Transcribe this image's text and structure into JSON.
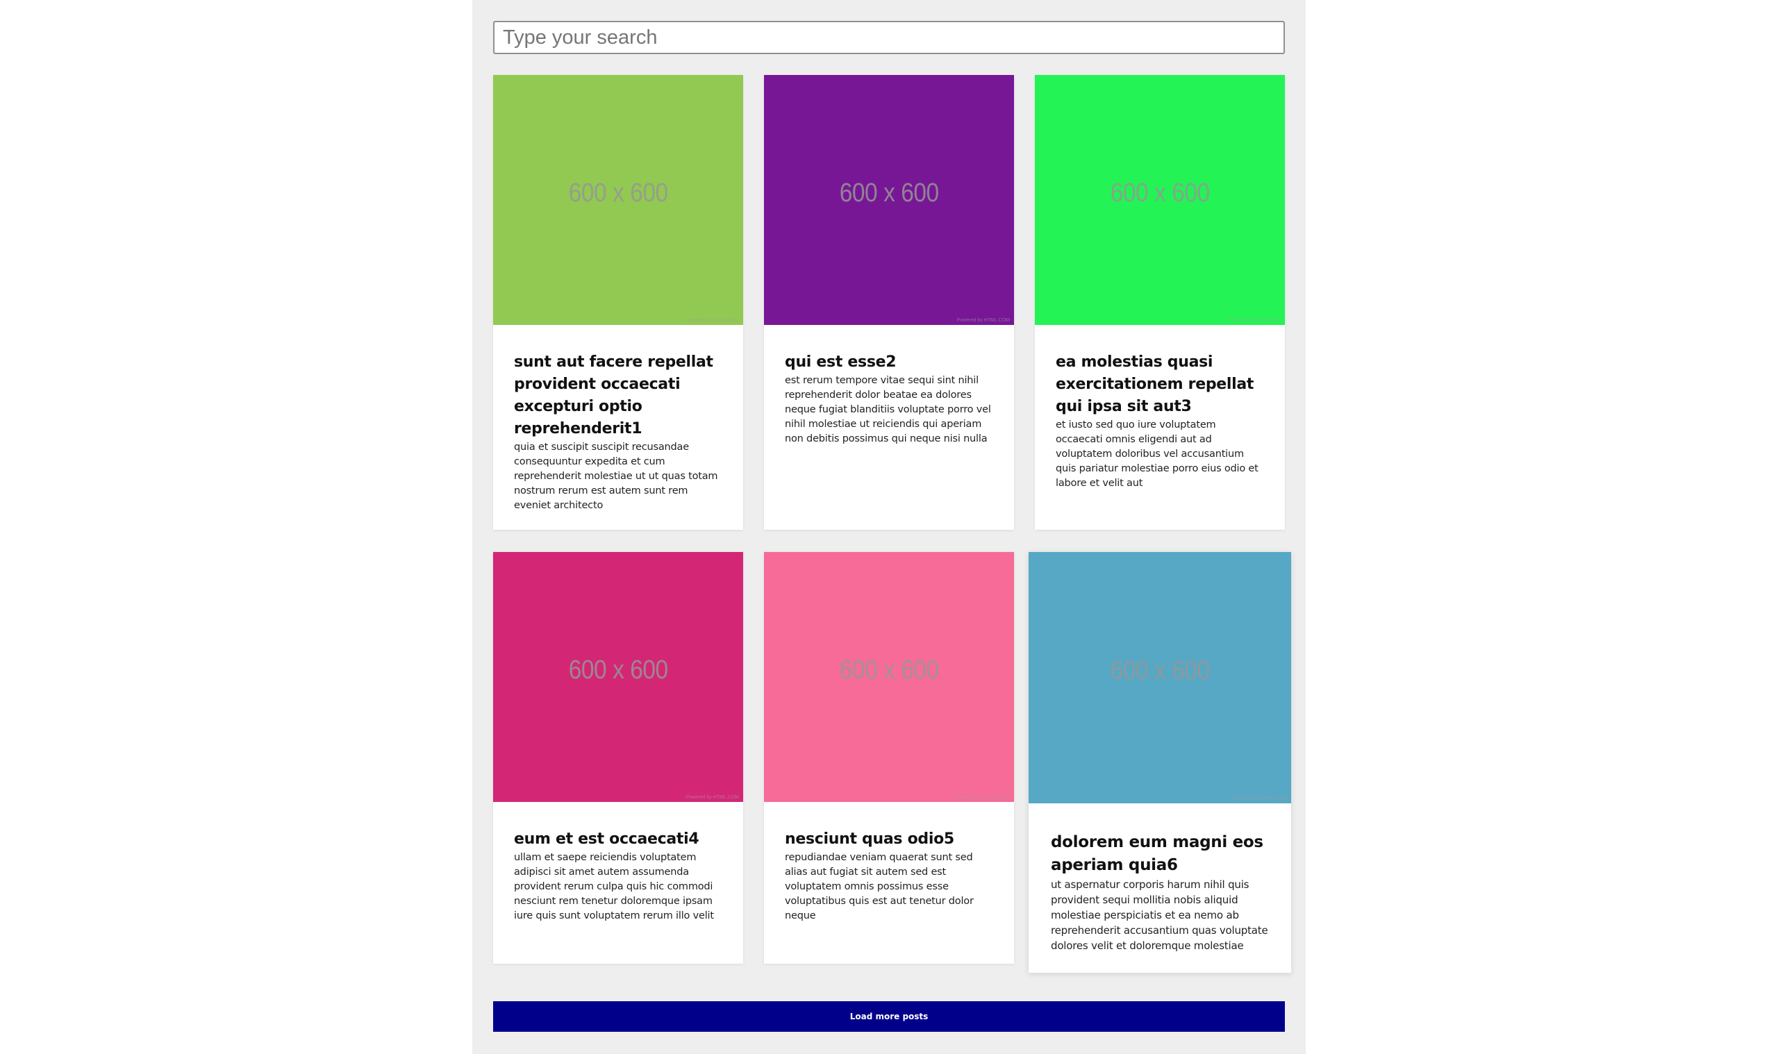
{
  "search": {
    "placeholder": "Type your search",
    "value": ""
  },
  "posts": [
    {
      "image_label": "600 x 600",
      "image_powered": "Powered by HTML.COM",
      "image_color": "#92c952",
      "title": "sunt aut facere repellat provident occaecati excepturi optio reprehenderit1",
      "body": "quia et suscipit suscipit recusandae consequuntur expedita et cum reprehenderit molestiae ut ut quas totam nostrum rerum est autem sunt rem eveniet architecto"
    },
    {
      "image_label": "600 x 600",
      "image_powered": "Powered by HTML.COM",
      "image_color": "#771796",
      "title": "qui est esse2",
      "body": "est rerum tempore vitae sequi sint nihil reprehenderit dolor beatae ea dolores neque fugiat blanditiis voluptate porro vel nihil molestiae ut reiciendis qui aperiam non debitis possimus qui neque nisi nulla"
    },
    {
      "image_label": "600 x 600",
      "image_powered": "Powered by HTML.COM",
      "image_color": "#24f355",
      "title": "ea molestias quasi exercitationem repellat qui ipsa sit aut3",
      "body": "et iusto sed quo iure voluptatem occaecati omnis eligendi aut ad voluptatem doloribus vel accusantium quis pariatur molestiae porro eius odio et labore et velit aut"
    },
    {
      "image_label": "600 x 600",
      "image_powered": "Powered by HTML.COM",
      "image_color": "#d32776",
      "title": "eum et est occaecati4",
      "body": "ullam et saepe reiciendis voluptatem adipisci sit amet autem assumenda provident rerum culpa quis hic commodi nesciunt rem tenetur doloremque ipsam iure quis sunt voluptatem rerum illo velit"
    },
    {
      "image_label": "600 x 600",
      "image_powered": "Powered by HTML.COM",
      "image_color": "#f66b97",
      "title": "nesciunt quas odio5",
      "body": "repudiandae veniam quaerat sunt sed alias aut fugiat sit autem sed est voluptatem omnis possimus esse voluptatibus quis est aut tenetur dolor neque"
    },
    {
      "image_label": "600 x 600",
      "image_powered": "Powered by HTML.COM",
      "image_color": "#56a8c5",
      "title": "dolorem eum magni eos aperiam quia6",
      "body": "ut aspernatur corporis harum nihil quis provident sequi mollitia nobis aliquid molestiae perspiciatis et ea nemo ab reprehenderit accusantium quas voluptate dolores velit et doloremque molestiae"
    }
  ],
  "load_more": {
    "label": "Load more posts",
    "color": "#00008b"
  }
}
